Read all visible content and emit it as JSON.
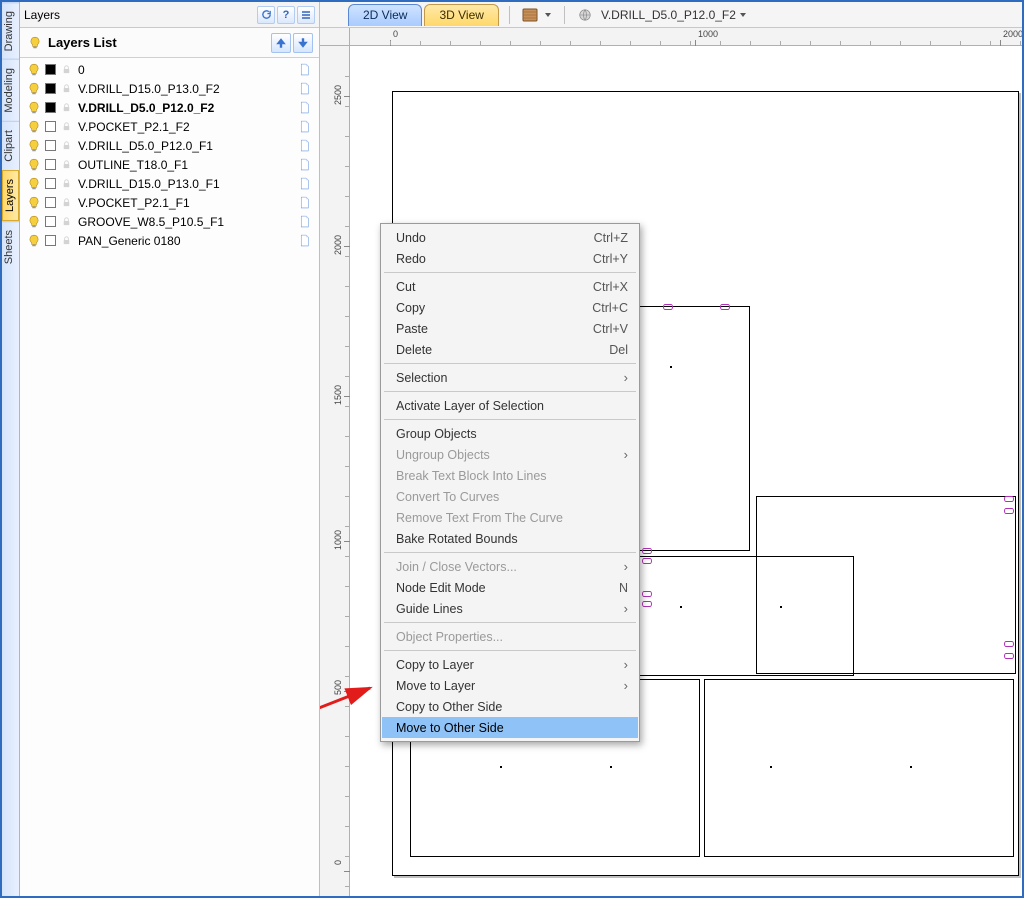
{
  "panel": {
    "title": "Layers",
    "list_label": "Layers List",
    "head_icons": [
      "refresh",
      "help",
      "menu"
    ]
  },
  "vtabs": [
    "Drawing",
    "Modeling",
    "Clipart",
    "Layers",
    "Sheets"
  ],
  "vtab_active": 3,
  "layers": [
    {
      "name": "0",
      "color": "#000000",
      "vis": true,
      "sel": false
    },
    {
      "name": "V.DRILL_D15.0_P13.0_F2",
      "color": "#000000",
      "vis": true,
      "sel": false
    },
    {
      "name": "V.DRILL_D5.0_P12.0_F2",
      "color": "#000000",
      "vis": true,
      "sel": true
    },
    {
      "name": "V.POCKET_P2.1_F2",
      "color": "#ffffff",
      "vis": true,
      "sel": false
    },
    {
      "name": "V.DRILL_D5.0_P12.0_F1",
      "color": "#ffffff",
      "vis": true,
      "sel": false
    },
    {
      "name": "OUTLINE_T18.0_F1",
      "color": "#ffffff",
      "vis": true,
      "sel": false
    },
    {
      "name": "V.DRILL_D15.0_P13.0_F1",
      "color": "#ffffff",
      "vis": true,
      "sel": false
    },
    {
      "name": "V.POCKET_P2.1_F1",
      "color": "#ffffff",
      "vis": true,
      "sel": false
    },
    {
      "name": "GROOVE_W8.5_P10.5_F1",
      "color": "#ffffff",
      "vis": true,
      "sel": false
    },
    {
      "name": "PAN_Generic 0180",
      "color": "#ffffff",
      "vis": true,
      "sel": false
    }
  ],
  "topbar": {
    "tab_2d": "2D View",
    "tab_3d": "3D View",
    "doc_title": "V.DRILL_D5.0_P12.0_F2"
  },
  "ruler_h": [
    {
      "v": "0",
      "p": 40
    },
    {
      "v": "1000",
      "p": 345
    },
    {
      "v": "2000",
      "p": 650
    }
  ],
  "ruler_v": [
    {
      "v": "2500",
      "p": 50
    },
    {
      "v": "2000",
      "p": 200
    },
    {
      "v": "1500",
      "p": 350
    },
    {
      "v": "1000",
      "p": 495
    },
    {
      "v": "500",
      "p": 645
    },
    {
      "v": "0",
      "p": 825
    }
  ],
  "ruler_corner": "",
  "context_menu": [
    {
      "t": "item",
      "label": "Undo",
      "shortcut": "Ctrl+Z"
    },
    {
      "t": "item",
      "label": "Redo",
      "shortcut": "Ctrl+Y"
    },
    {
      "t": "sep"
    },
    {
      "t": "item",
      "label": "Cut",
      "shortcut": "Ctrl+X"
    },
    {
      "t": "item",
      "label": "Copy",
      "shortcut": "Ctrl+C"
    },
    {
      "t": "item",
      "label": "Paste",
      "shortcut": "Ctrl+V"
    },
    {
      "t": "item",
      "label": "Delete",
      "shortcut": "Del"
    },
    {
      "t": "sep"
    },
    {
      "t": "item",
      "label": "Selection",
      "sub": true
    },
    {
      "t": "sep"
    },
    {
      "t": "item",
      "label": "Activate Layer of Selection"
    },
    {
      "t": "sep"
    },
    {
      "t": "item",
      "label": "Group Objects"
    },
    {
      "t": "item",
      "label": "Ungroup Objects",
      "sub": true,
      "dis": true
    },
    {
      "t": "item",
      "label": "Break Text Block Into Lines",
      "dis": true
    },
    {
      "t": "item",
      "label": "Convert To Curves",
      "dis": true
    },
    {
      "t": "item",
      "label": "Remove Text From The Curve",
      "dis": true
    },
    {
      "t": "item",
      "label": "Bake Rotated Bounds"
    },
    {
      "t": "sep"
    },
    {
      "t": "item",
      "label": "Join / Close Vectors...",
      "sub": true,
      "dis": true
    },
    {
      "t": "item",
      "label": "Node Edit Mode",
      "shortcut": "N"
    },
    {
      "t": "item",
      "label": "Guide Lines",
      "sub": true
    },
    {
      "t": "sep"
    },
    {
      "t": "item",
      "label": "Object Properties...",
      "dis": true
    },
    {
      "t": "sep"
    },
    {
      "t": "item",
      "label": "Copy to Layer",
      "sub": true
    },
    {
      "t": "item",
      "label": "Move to Layer",
      "sub": true
    },
    {
      "t": "item",
      "label": "Copy to Other Side"
    },
    {
      "t": "item",
      "label": "Move to Other Side",
      "hl": true
    }
  ]
}
